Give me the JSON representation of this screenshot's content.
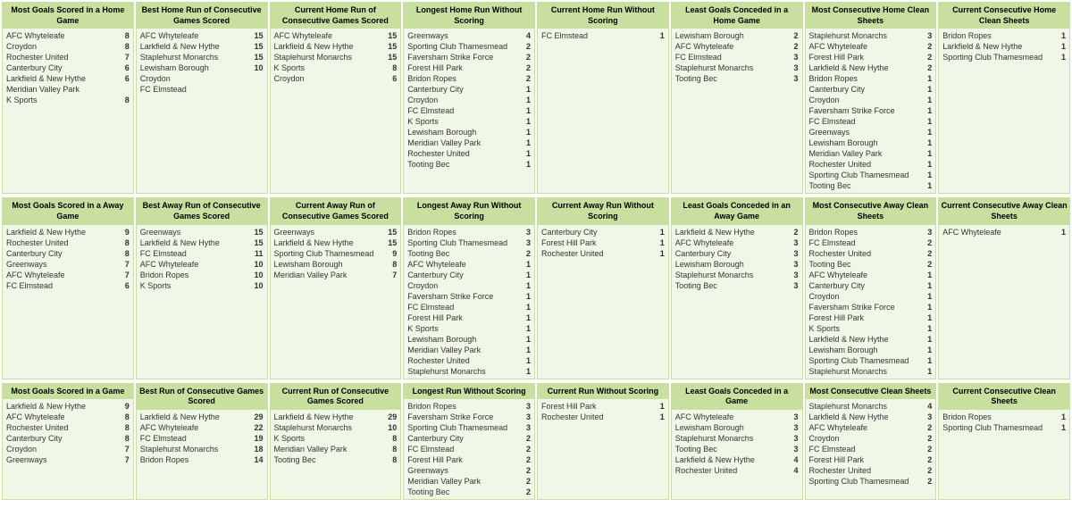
{
  "sections": [
    {
      "id": "row1",
      "panels": [
        {
          "id": "most-goals-home-game",
          "header": "Most Goals Scored in a Home Game",
          "rows": [
            {
              "team": "AFC Whyteleafe",
              "val": "8"
            },
            {
              "team": "Croydon",
              "val": "8"
            },
            {
              "team": "Rochester United",
              "val": "7"
            },
            {
              "team": "Canterbury City",
              "val": "6"
            },
            {
              "team": "Larkfield & New Hythe",
              "val": "6"
            },
            {
              "team": "Meridian Valley Park",
              "val": ""
            },
            {
              "team": "K Sports",
              "val": "8"
            }
          ]
        },
        {
          "id": "best-home-run-consecutive",
          "header": "Best Home Run of Consecutive Games Scored",
          "rows": [
            {
              "team": "AFC Whyteleafe",
              "val": "15"
            },
            {
              "team": "Larkfield & New Hythe",
              "val": "15"
            },
            {
              "team": "Staplehurst Monarchs",
              "val": "15"
            },
            {
              "team": "Lewisham Borough",
              "val": "10"
            },
            {
              "team": "Croydon",
              "val": ""
            },
            {
              "team": "FC Elmstead",
              "val": ""
            },
            {
              "team": "",
              "val": ""
            }
          ]
        },
        {
          "id": "current-home-run-consecutive",
          "header": "Current Home Run of Consecutive Games Scored",
          "rows": [
            {
              "team": "AFC Whyteleafe",
              "val": "15"
            },
            {
              "team": "Larkfield & New Hythe",
              "val": "15"
            },
            {
              "team": "Staplehurst Monarchs",
              "val": "15"
            },
            {
              "team": "K Sports",
              "val": "8"
            },
            {
              "team": "Croydon",
              "val": "6"
            },
            {
              "team": "",
              "val": ""
            },
            {
              "team": "",
              "val": ""
            }
          ]
        },
        {
          "id": "longest-home-run-without-scoring",
          "header": "Longest Home Run Without Scoring",
          "rows": [
            {
              "team": "Greenways",
              "val": "4"
            },
            {
              "team": "Sporting Club Thamesmead",
              "val": "2"
            },
            {
              "team": "Faversham Strike Force",
              "val": "2"
            },
            {
              "team": "Forest Hill Park",
              "val": "2"
            },
            {
              "team": "Bridon Ropes",
              "val": "2"
            },
            {
              "team": "Canterbury City",
              "val": "1"
            },
            {
              "team": "Croydon",
              "val": "1"
            },
            {
              "team": "FC Elmstead",
              "val": "1"
            },
            {
              "team": "K Sports",
              "val": "1"
            },
            {
              "team": "Lewisham Borough",
              "val": "1"
            },
            {
              "team": "Meridian Valley Park",
              "val": "1"
            },
            {
              "team": "Rochester United",
              "val": "1"
            },
            {
              "team": "Tooting Bec",
              "val": "1"
            }
          ]
        },
        {
          "id": "current-home-run-without-scoring",
          "header": "Current Home Run Without Scoring",
          "rows": [
            {
              "team": "FC Elmstead",
              "val": "1"
            }
          ]
        },
        {
          "id": "least-goals-conceded-home",
          "header": "Least Goals Conceded in a Home Game",
          "rows": [
            {
              "team": "Lewisham Borough",
              "val": "2"
            },
            {
              "team": "AFC Whyteleafe",
              "val": "2"
            },
            {
              "team": "FC Elmstead",
              "val": "3"
            },
            {
              "team": "Staplehurst Monarchs",
              "val": "3"
            },
            {
              "team": "Tooting Bec",
              "val": "3"
            }
          ]
        },
        {
          "id": "most-consecutive-home-clean-sheets",
          "header": "Most Consecutive Home Clean Sheets",
          "rows": [
            {
              "team": "Staplehurst Monarchs",
              "val": "3"
            },
            {
              "team": "AFC Whyteleafe",
              "val": "2"
            },
            {
              "team": "Forest Hill Park",
              "val": "2"
            },
            {
              "team": "Larkfield & New Hythe",
              "val": "2"
            },
            {
              "team": "Bridon Ropes",
              "val": "1"
            },
            {
              "team": "Canterbury City",
              "val": "1"
            },
            {
              "team": "Croydon",
              "val": "1"
            },
            {
              "team": "Faversham Strike Force",
              "val": "1"
            },
            {
              "team": "FC Elmstead",
              "val": "1"
            },
            {
              "team": "Greenways",
              "val": "1"
            },
            {
              "team": "Lewisham Borough",
              "val": "1"
            },
            {
              "team": "Meridian Valley Park",
              "val": "1"
            },
            {
              "team": "Rochester United",
              "val": "1"
            },
            {
              "team": "Sporting Club Thamesmead",
              "val": "1"
            },
            {
              "team": "Tooting Bec",
              "val": "1"
            }
          ]
        },
        {
          "id": "current-consecutive-home-clean-sheets",
          "header": "Current Consecutive Home Clean Sheets",
          "rows": [
            {
              "team": "Bridon Ropes",
              "val": "1"
            },
            {
              "team": "Larkfield & New Hythe",
              "val": "1"
            },
            {
              "team": "Sporting Club Thamesmead",
              "val": "1"
            }
          ]
        }
      ]
    },
    {
      "id": "row2",
      "panels": [
        {
          "id": "most-goals-away-game",
          "header": "Most Goals Scored in a Away Game",
          "rows": [
            {
              "team": "Larkfield & New Hythe",
              "val": "9"
            },
            {
              "team": "Rochester United",
              "val": "8"
            },
            {
              "team": "Canterbury City",
              "val": "8"
            },
            {
              "team": "Greenways",
              "val": "7"
            },
            {
              "team": "AFC Whyteleafe",
              "val": "7"
            },
            {
              "team": "FC Elmstead",
              "val": "6"
            }
          ]
        },
        {
          "id": "best-away-run-consecutive",
          "header": "Best Away Run of Consecutive Games Scored",
          "rows": [
            {
              "team": "Greenways",
              "val": "15"
            },
            {
              "team": "Larkfield & New Hythe",
              "val": "15"
            },
            {
              "team": "FC Elmstead",
              "val": "11"
            },
            {
              "team": "AFC Whyteleafe",
              "val": "10"
            },
            {
              "team": "Bridon Ropes",
              "val": "10"
            },
            {
              "team": "K Sports",
              "val": "10"
            }
          ]
        },
        {
          "id": "current-away-run-consecutive",
          "header": "Current Away Run of Consecutive Games Scored",
          "rows": [
            {
              "team": "Greenways",
              "val": "15"
            },
            {
              "team": "Larkfield & New Hythe",
              "val": "15"
            },
            {
              "team": "Sporting Club Thamesmead",
              "val": "9"
            },
            {
              "team": "Lewisham Borough",
              "val": "8"
            },
            {
              "team": "Meridian Valley Park",
              "val": "7"
            }
          ]
        },
        {
          "id": "longest-away-run-without-scoring",
          "header": "Longest Away Run Without Scoring",
          "rows": [
            {
              "team": "Bridon Ropes",
              "val": "3"
            },
            {
              "team": "Sporting Club Thamesmead",
              "val": "3"
            },
            {
              "team": "Tooting Bec",
              "val": "2"
            },
            {
              "team": "AFC Whyteleafe",
              "val": "1"
            },
            {
              "team": "Canterbury City",
              "val": "1"
            },
            {
              "team": "Croydon",
              "val": "1"
            },
            {
              "team": "Faversham Strike Force",
              "val": "1"
            },
            {
              "team": "FC Elmstead",
              "val": "1"
            },
            {
              "team": "Forest Hill Park",
              "val": "1"
            },
            {
              "team": "K Sports",
              "val": "1"
            },
            {
              "team": "Lewisham Borough",
              "val": "1"
            },
            {
              "team": "Meridian Valley Park",
              "val": "1"
            },
            {
              "team": "Rochester United",
              "val": "1"
            },
            {
              "team": "Staplehurst Monarchs",
              "val": "1"
            }
          ]
        },
        {
          "id": "current-away-run-without-scoring",
          "header": "Current Away Run Without Scoring",
          "rows": [
            {
              "team": "Canterbury City",
              "val": "1"
            },
            {
              "team": "Forest Hill Park",
              "val": "1"
            },
            {
              "team": "Rochester United",
              "val": "1"
            }
          ]
        },
        {
          "id": "least-goals-conceded-away",
          "header": "Least Goals Conceded in an Away Game",
          "rows": [
            {
              "team": "Larkfield & New Hythe",
              "val": "2"
            },
            {
              "team": "AFC Whyteleafe",
              "val": "3"
            },
            {
              "team": "Canterbury City",
              "val": "3"
            },
            {
              "team": "Lewisham Borough",
              "val": "3"
            },
            {
              "team": "Staplehurst Monarchs",
              "val": "3"
            },
            {
              "team": "Tooting Bec",
              "val": "3"
            }
          ]
        },
        {
          "id": "most-consecutive-away-clean-sheets",
          "header": "Most Consecutive Away Clean Sheets",
          "rows": [
            {
              "team": "Bridon Ropes",
              "val": "3"
            },
            {
              "team": "FC Elmstead",
              "val": "2"
            },
            {
              "team": "Rochester United",
              "val": "2"
            },
            {
              "team": "Tooting Bec",
              "val": "2"
            },
            {
              "team": "AFC Whyteleafe",
              "val": "1"
            },
            {
              "team": "Canterbury City",
              "val": "1"
            },
            {
              "team": "Croydon",
              "val": "1"
            },
            {
              "team": "Faversham Strike Force",
              "val": "1"
            },
            {
              "team": "Forest Hill Park",
              "val": "1"
            },
            {
              "team": "K Sports",
              "val": "1"
            },
            {
              "team": "Larkfield & New Hythe",
              "val": "1"
            },
            {
              "team": "Lewisham Borough",
              "val": "1"
            },
            {
              "team": "Sporting Club Thamesmead",
              "val": "1"
            },
            {
              "team": "Staplehurst Monarchs",
              "val": "1"
            }
          ]
        },
        {
          "id": "current-consecutive-away-clean-sheets",
          "header": "Current Consecutive Away Clean Sheets",
          "rows": [
            {
              "team": "AFC Whyteleafe",
              "val": "1"
            }
          ]
        }
      ]
    },
    {
      "id": "row3",
      "panels": [
        {
          "id": "most-goals-game",
          "header": "Most Goals Scored in a Game",
          "rows": [
            {
              "team": "Larkfield & New Hythe",
              "val": "9"
            },
            {
              "team": "AFC Whyteleafe",
              "val": "8"
            },
            {
              "team": "Rochester United",
              "val": "8"
            },
            {
              "team": "Canterbury City",
              "val": "8"
            },
            {
              "team": "Croydon",
              "val": "7"
            },
            {
              "team": "Greenways",
              "val": "7"
            }
          ]
        },
        {
          "id": "best-run-consecutive-games-scored",
          "header": "Best Run of Consecutive Games Scored",
          "rows": [
            {
              "team": "Larkfield & New Hythe",
              "val": "29"
            },
            {
              "team": "AFC Whyteleafe",
              "val": "22"
            },
            {
              "team": "FC Elmstead",
              "val": "19"
            },
            {
              "team": "Staplehurst Monarchs",
              "val": "18"
            },
            {
              "team": "Bridon Ropes",
              "val": "14"
            }
          ]
        },
        {
          "id": "current-run-consecutive-games-scored",
          "header": "Current Run of Consecutive Games Scored",
          "rows": [
            {
              "team": "Larkfield & New Hythe",
              "val": "29"
            },
            {
              "team": "Staplehurst Monarchs",
              "val": "10"
            },
            {
              "team": "K Sports",
              "val": "8"
            },
            {
              "team": "Meridian Valley Park",
              "val": "8"
            },
            {
              "team": "Tooting Bec",
              "val": "8"
            }
          ]
        },
        {
          "id": "longest-run-without-scoring",
          "header": "Longest Run Without Scoring",
          "rows": [
            {
              "team": "Bridon Ropes",
              "val": "3"
            },
            {
              "team": "Faversham Strike Force",
              "val": "3"
            },
            {
              "team": "Sporting Club Thamesmead",
              "val": "3"
            },
            {
              "team": "Canterbury City",
              "val": "2"
            },
            {
              "team": "FC Elmstead",
              "val": "2"
            },
            {
              "team": "Forest Hill Park",
              "val": "2"
            },
            {
              "team": "Greenways",
              "val": "2"
            },
            {
              "team": "Meridian Valley Park",
              "val": "2"
            },
            {
              "team": "Tooting Bec",
              "val": "2"
            }
          ]
        },
        {
          "id": "current-run-without-scoring",
          "header": "Current Run Without Scoring",
          "rows": [
            {
              "team": "Forest Hill Park",
              "val": "1"
            },
            {
              "team": "Rochester United",
              "val": "1"
            }
          ]
        },
        {
          "id": "least-goals-conceded-game",
          "header": "Least Goals Conceded in a Game",
          "rows": [
            {
              "team": "AFC Whyteleafe",
              "val": "3"
            },
            {
              "team": "Lewisham Borough",
              "val": "3"
            },
            {
              "team": "Staplehurst Monarchs",
              "val": "3"
            },
            {
              "team": "Tooting Bec",
              "val": "3"
            },
            {
              "team": "Larkfield & New Hythe",
              "val": "4"
            },
            {
              "team": "Rochester United",
              "val": "4"
            }
          ]
        },
        {
          "id": "most-consecutive-clean-sheets",
          "header": "Most Consecutive Clean Sheets",
          "rows": [
            {
              "team": "Staplehurst Monarchs",
              "val": "4"
            },
            {
              "team": "Larkfield & New Hythe",
              "val": "3"
            },
            {
              "team": "AFC Whyteleafe",
              "val": "2"
            },
            {
              "team": "Croydon",
              "val": "2"
            },
            {
              "team": "FC Elmstead",
              "val": "2"
            },
            {
              "team": "Forest Hill Park",
              "val": "2"
            },
            {
              "team": "Rochester United",
              "val": "2"
            },
            {
              "team": "Sporting Club Thamesmead",
              "val": "2"
            }
          ]
        },
        {
          "id": "current-consecutive-clean-sheets",
          "header": "Current Consecutive Clean Sheets",
          "rows": [
            {
              "team": "Bridon Ropes",
              "val": "1"
            },
            {
              "team": "Sporting Club Thamesmead",
              "val": "1"
            }
          ]
        }
      ]
    }
  ]
}
